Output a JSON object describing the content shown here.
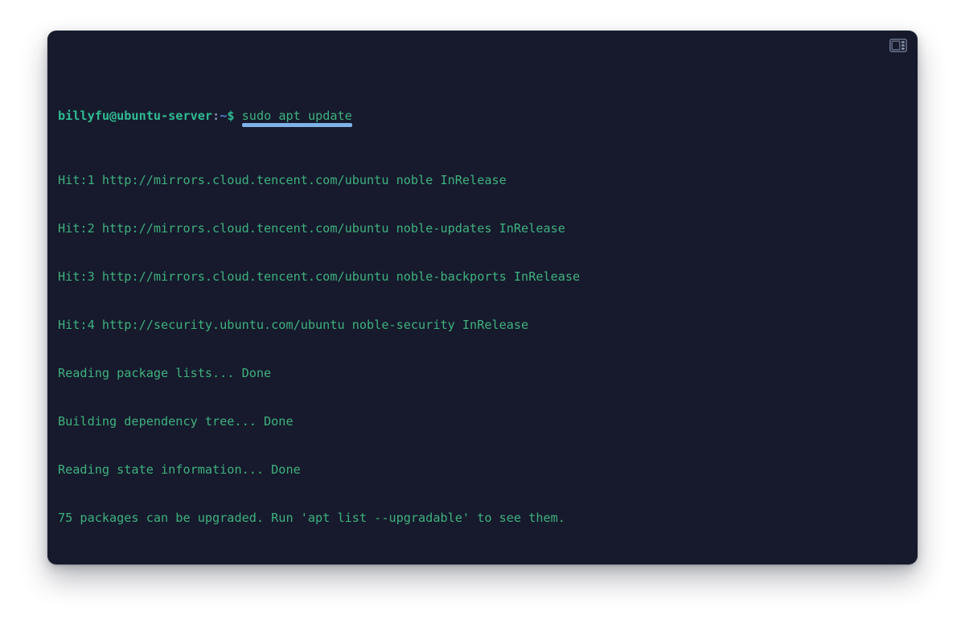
{
  "window": {
    "background_color": "#161a2c",
    "page_background_color": "#ffffff",
    "titlebar": {
      "panel_toggle_icon": "panel-layout-icon"
    }
  },
  "colors": {
    "output_green": "#3fb07f",
    "prompt_green": "#2fbb92",
    "prompt_path_blue": "#4e86d6",
    "command_underline_blue": "#7fb3e8",
    "cursor_green": "#3ddc84"
  },
  "terminal": {
    "prompt": {
      "user_host": "billyfu@ubuntu-server",
      "colon": ":",
      "path": "~",
      "dollar": "$"
    },
    "command": "sudo apt update",
    "output_lines": [
      "Hit:1 http://mirrors.cloud.tencent.com/ubuntu noble InRelease",
      "Hit:2 http://mirrors.cloud.tencent.com/ubuntu noble-updates InRelease",
      "Hit:3 http://mirrors.cloud.tencent.com/ubuntu noble-backports InRelease",
      "Hit:4 http://security.ubuntu.com/ubuntu noble-security InRelease",
      "Reading package lists... Done",
      "Building dependency tree... Done",
      "Reading state information... Done",
      "75 packages can be upgraded. Run 'apt list --upgradable' to see them."
    ]
  }
}
